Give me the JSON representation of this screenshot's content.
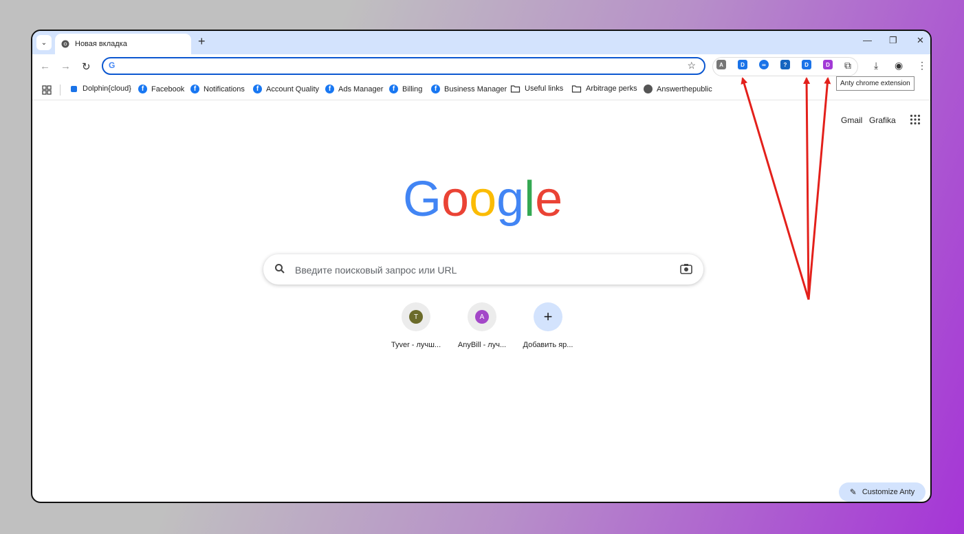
{
  "tab": {
    "title": "Новая вкладка"
  },
  "tooltip": "Anty chrome extension",
  "bookmarks": [
    {
      "label": "Dolphin{cloud}",
      "icon": "dolphin-icon"
    },
    {
      "label": "Facebook",
      "icon": "facebook-icon"
    },
    {
      "label": "Notifications",
      "icon": "facebook-icon"
    },
    {
      "label": "Account Quality",
      "icon": "facebook-icon"
    },
    {
      "label": "Ads Manager",
      "icon": "facebook-icon"
    },
    {
      "label": "Billing",
      "icon": "facebook-icon"
    },
    {
      "label": "Business Manager",
      "icon": "facebook-icon"
    },
    {
      "label": "Useful links",
      "icon": "folder-icon"
    },
    {
      "label": "Arbitrage perks",
      "icon": "folder-icon"
    },
    {
      "label": "Answerthepublic",
      "icon": "globe-icon"
    }
  ],
  "header": {
    "gmail": "Gmail",
    "images": "Grafika"
  },
  "search": {
    "placeholder": "Введите поисковый запрос или URL"
  },
  "shortcuts": [
    {
      "initial": "T",
      "label": "Tyver - лучш...",
      "color": "#6b6b2a"
    },
    {
      "initial": "A",
      "label": "AnyBill - луч...",
      "color": "#a347c8"
    },
    {
      "initial": "+",
      "label": "Добавить яр..."
    }
  ],
  "customize": {
    "label": "Customize Anty"
  },
  "colors": {
    "accent": "#0b57d0",
    "arrow": "#e3201b",
    "tab_strip": "#d3e3fd"
  }
}
